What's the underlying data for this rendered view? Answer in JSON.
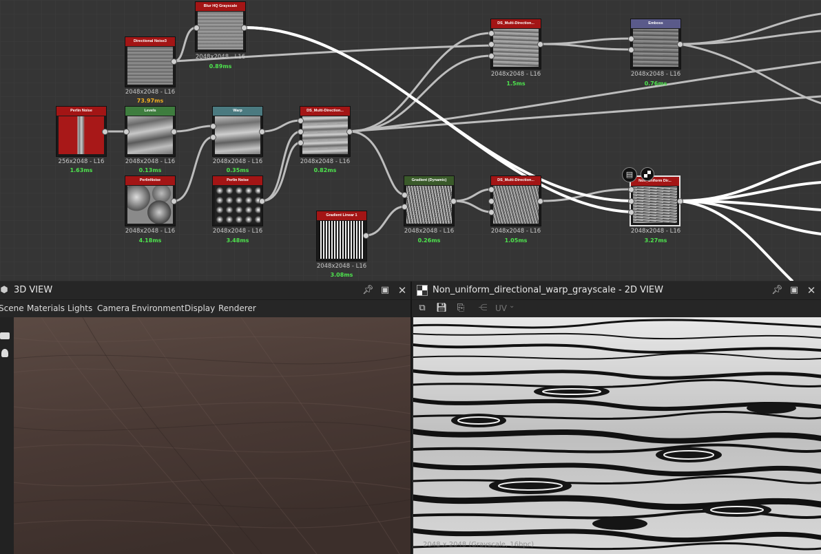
{
  "graph": {
    "nodes": [
      {
        "id": "perlin",
        "title": "Perlin Noise",
        "resolution": "256x2048 - L16",
        "time": "1.63ms",
        "header_color": "#a31515",
        "time_color": "#4ee44e"
      },
      {
        "id": "dirnoise",
        "title": "Directional Noise3",
        "resolution": "2048x2048 - L16",
        "time": "73.97ms",
        "header_color": "#a31515",
        "time_color": "#f0b020"
      },
      {
        "id": "blurhq",
        "title": "Blur HQ Grayscale",
        "resolution": "2048x2048 - L16",
        "time": "0.89ms",
        "header_color": "#a31515",
        "time_color": "#4ee44e"
      },
      {
        "id": "levels",
        "title": "Levels",
        "resolution": "2048x2048 - L16",
        "time": "0.13ms",
        "header_color": "#3e7d3e",
        "time_color": "#4ee44e"
      },
      {
        "id": "warp",
        "title": "Warp",
        "resolution": "2048x2048 - L16",
        "time": "0.35ms",
        "header_color": "#4b7a80",
        "time_color": "#4ee44e"
      },
      {
        "id": "dsmulti1",
        "title": "DS_Multi-Direction...",
        "resolution": "2048x2048 - L16",
        "time": "0.82ms",
        "header_color": "#a31515",
        "time_color": "#4ee44e"
      },
      {
        "id": "perlinnoise2",
        "title": "PerlinNoise",
        "resolution": "2048x2048 - L16",
        "time": "4.18ms",
        "header_color": "#a31515",
        "time_color": "#4ee44e"
      },
      {
        "id": "perlinnoise3",
        "title": "Perlin Noise",
        "resolution": "2048x2048 - L16",
        "time": "3.48ms",
        "header_color": "#a31515",
        "time_color": "#4ee44e"
      },
      {
        "id": "gradlinear",
        "title": "Gradient Linear 1",
        "resolution": "2048x2048 - L16",
        "time": "3.08ms",
        "header_color": "#a31515",
        "time_color": "#4ee44e"
      },
      {
        "id": "graddyn",
        "title": "Gradient (Dynamic)",
        "resolution": "2048x2048 - L16",
        "time": "0.26ms",
        "header_color": "#3a5a2a",
        "time_color": "#4ee44e"
      },
      {
        "id": "dsmulti2",
        "title": "DS_Multi-Direction...",
        "resolution": "2048x2048 - L16",
        "time": "1.05ms",
        "header_color": "#a31515",
        "time_color": "#4ee44e"
      },
      {
        "id": "dsmulti3",
        "title": "DS_Multi-Direction...",
        "resolution": "2048x2048 - L16",
        "time": "1.5ms",
        "header_color": "#a31515",
        "time_color": "#4ee44e"
      },
      {
        "id": "emboss",
        "title": "Emboss",
        "resolution": "2048x2048 - L16",
        "time": "0.76ms",
        "header_color": "#5a5a8a",
        "time_color": "#4ee44e"
      },
      {
        "id": "nonuniform",
        "title": "Non_uniform Dir...",
        "resolution": "2048x2048 - L16",
        "time": "3.27ms",
        "header_color": "#a31515",
        "time_color": "#4ee44e"
      }
    ]
  },
  "view3d": {
    "title": "3D VIEW",
    "menu": [
      "Scene",
      "Materials",
      "Lights",
      "Camera",
      "Environment",
      "Display",
      "Renderer"
    ]
  },
  "view2d": {
    "title": "Non_uniform_directional_warp_grayscale - 2D VIEW",
    "uv_label": "UV",
    "watermark": "2048 x 2048 (Grayscale, 16bpc)"
  },
  "icons": {
    "pin": "pin-icon",
    "maximize": "maximize-icon",
    "close": "close-icon",
    "cube": "cube-icon",
    "checker": "checker-icon"
  },
  "colors": {
    "accent_red": "#a31515",
    "time_green": "#4ee44e",
    "time_orange": "#f0b020"
  }
}
